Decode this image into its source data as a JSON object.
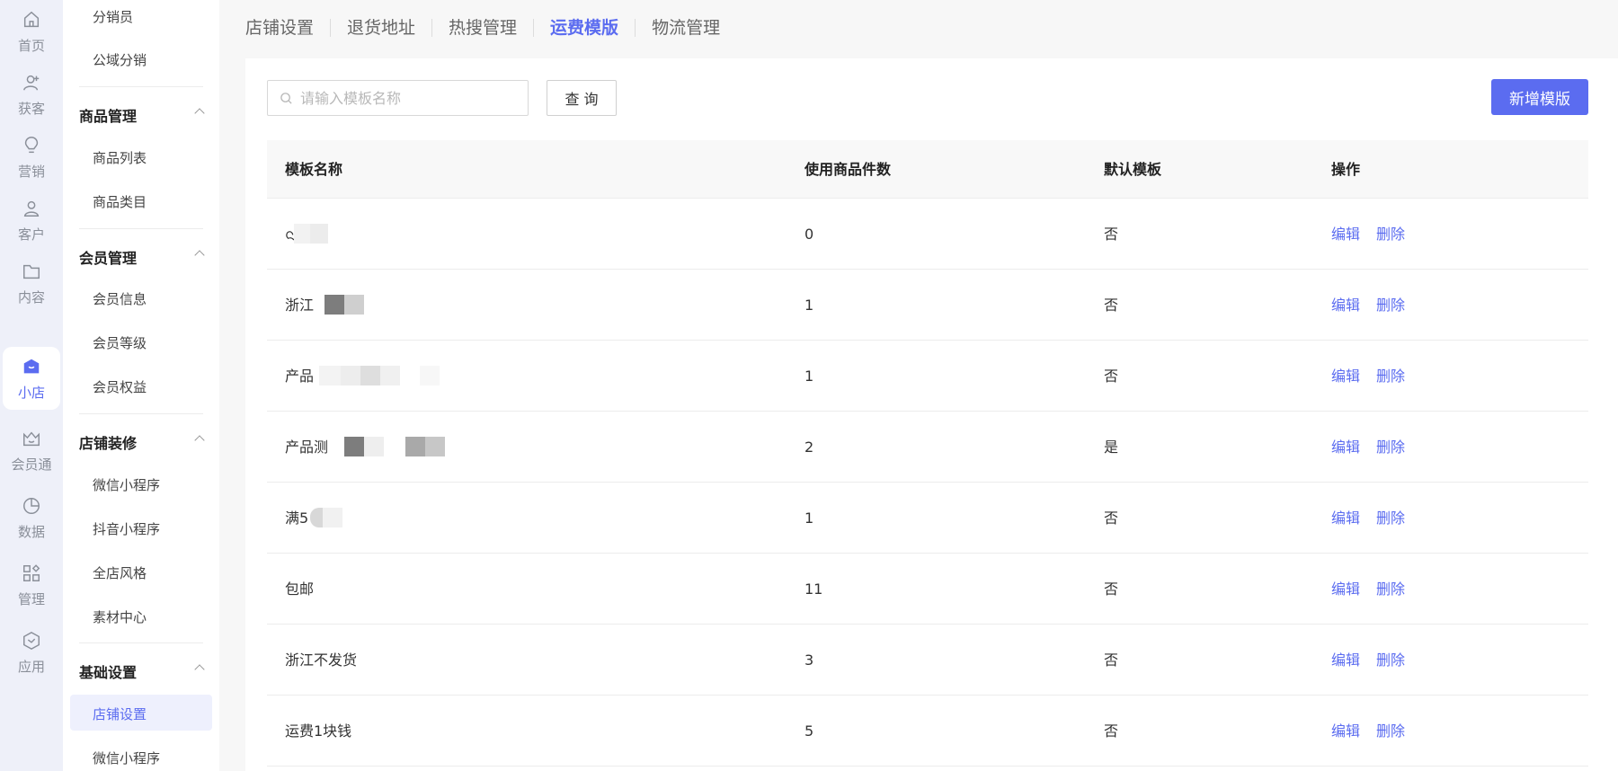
{
  "rail": [
    {
      "label": "首页",
      "icon": "home-icon"
    },
    {
      "label": "获客",
      "icon": "user-plus-icon"
    },
    {
      "label": "营销",
      "icon": "lightbulb-icon"
    },
    {
      "label": "客户",
      "icon": "user-icon"
    },
    {
      "label": "内容",
      "icon": "folder-icon"
    },
    {
      "label": "小店",
      "icon": "shop-icon",
      "active": true
    },
    {
      "label": "会员通",
      "icon": "crown-icon"
    },
    {
      "label": "数据",
      "icon": "pie-chart-icon"
    },
    {
      "label": "管理",
      "icon": "grid-icon"
    },
    {
      "label": "应用",
      "icon": "cube-icon"
    }
  ],
  "submenu": {
    "items_top": [
      "分销员",
      "公域分销"
    ],
    "groups": [
      {
        "title": "商品管理",
        "items": [
          "商品列表",
          "商品类目"
        ]
      },
      {
        "title": "会员管理",
        "items": [
          "会员信息",
          "会员等级",
          "会员权益"
        ]
      },
      {
        "title": "店铺装修",
        "items": [
          "微信小程序",
          "抖音小程序",
          "全店风格",
          "素材中心"
        ]
      },
      {
        "title": "基础设置",
        "items": [
          "店铺设置",
          "微信小程序"
        ]
      }
    ],
    "active_item": "店铺设置"
  },
  "tabs": [
    {
      "label": "店铺设置"
    },
    {
      "label": "退货地址"
    },
    {
      "label": "热搜管理"
    },
    {
      "label": "运费模版",
      "active": true
    },
    {
      "label": "物流管理"
    }
  ],
  "search": {
    "placeholder": "请输入模板名称",
    "value": ""
  },
  "query_button": "查 询",
  "add_button": "新增模版",
  "table": {
    "headers": [
      "模板名称",
      "使用商品件数",
      "默认模板",
      "操作"
    ],
    "rows": [
      {
        "name": "ᨶ",
        "count": "0",
        "default": "否"
      },
      {
        "name": "浙江",
        "count": "1",
        "default": "否"
      },
      {
        "name": "产品",
        "count": "1",
        "default": "否"
      },
      {
        "name": "产品测",
        "count": "2",
        "default": "是"
      },
      {
        "name": "满5",
        "count": "1",
        "default": "否"
      },
      {
        "name": "包邮",
        "count": "11",
        "default": "否"
      },
      {
        "name": "浙江不发货",
        "count": "3",
        "default": "否"
      },
      {
        "name": "运费1块钱",
        "count": "5",
        "default": "否"
      }
    ],
    "edit_label": "编辑",
    "delete_label": "删除"
  },
  "colors": {
    "accent": "#5b6cf0",
    "rail_bg": "#eef0f9"
  }
}
